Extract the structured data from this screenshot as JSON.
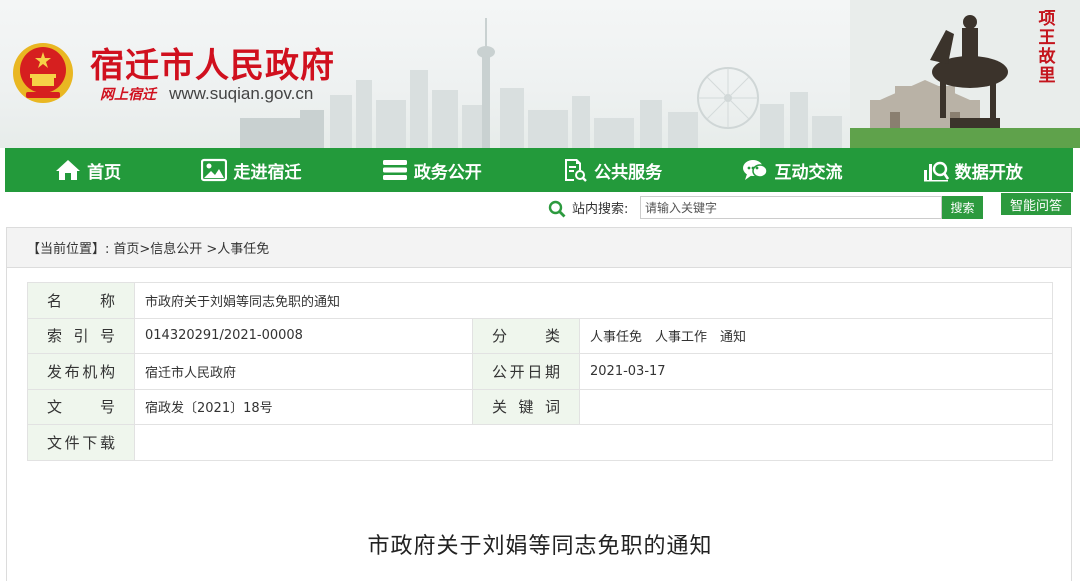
{
  "header": {
    "title": "宿迁市人民政府",
    "subtitle": "网上宿迁",
    "url": "www.suqian.gov.cn",
    "seal_text": "项王故里",
    "emblem_icon": "national-emblem-icon"
  },
  "nav": {
    "items": [
      {
        "label": "首页",
        "icon": "home-icon"
      },
      {
        "label": "走进宿迁",
        "icon": "picture-icon"
      },
      {
        "label": "政务公开",
        "icon": "server-stack-icon"
      },
      {
        "label": "公共服务",
        "icon": "document-search-icon"
      },
      {
        "label": "互动交流",
        "icon": "chat-bubble-icon"
      },
      {
        "label": "数据开放",
        "icon": "data-search-icon"
      }
    ]
  },
  "search": {
    "label": "站内搜索:",
    "placeholder": "请输入关键字",
    "button": "搜索",
    "qa_button": "智能问答"
  },
  "breadcrumb": {
    "prefix": "【当前位置】:",
    "path": "首页>信息公开 >人事任免"
  },
  "info": {
    "name_label": "名称",
    "name_value": "市政府关于刘娟等同志免职的通知",
    "index_label": "索引号",
    "index_value": "014320291/2021-00008",
    "category_label": "分类",
    "category_value": "人事任免　人事工作　通知",
    "publisher_label": "发布机构",
    "publisher_value": "宿迁市人民政府",
    "date_label": "公开日期",
    "date_value": "2021-03-17",
    "docno_label": "文号",
    "docno_value": "宿政发〔2021〕18号",
    "keywords_label": "关键词",
    "keywords_value": "",
    "download_label": "文件下载",
    "download_value": ""
  },
  "document": {
    "title": "市政府关于刘娟等同志免职的通知"
  },
  "colors": {
    "brand_red": "#d0101e",
    "nav_green": "#239a3b",
    "label_bg": "#eff6ed"
  }
}
